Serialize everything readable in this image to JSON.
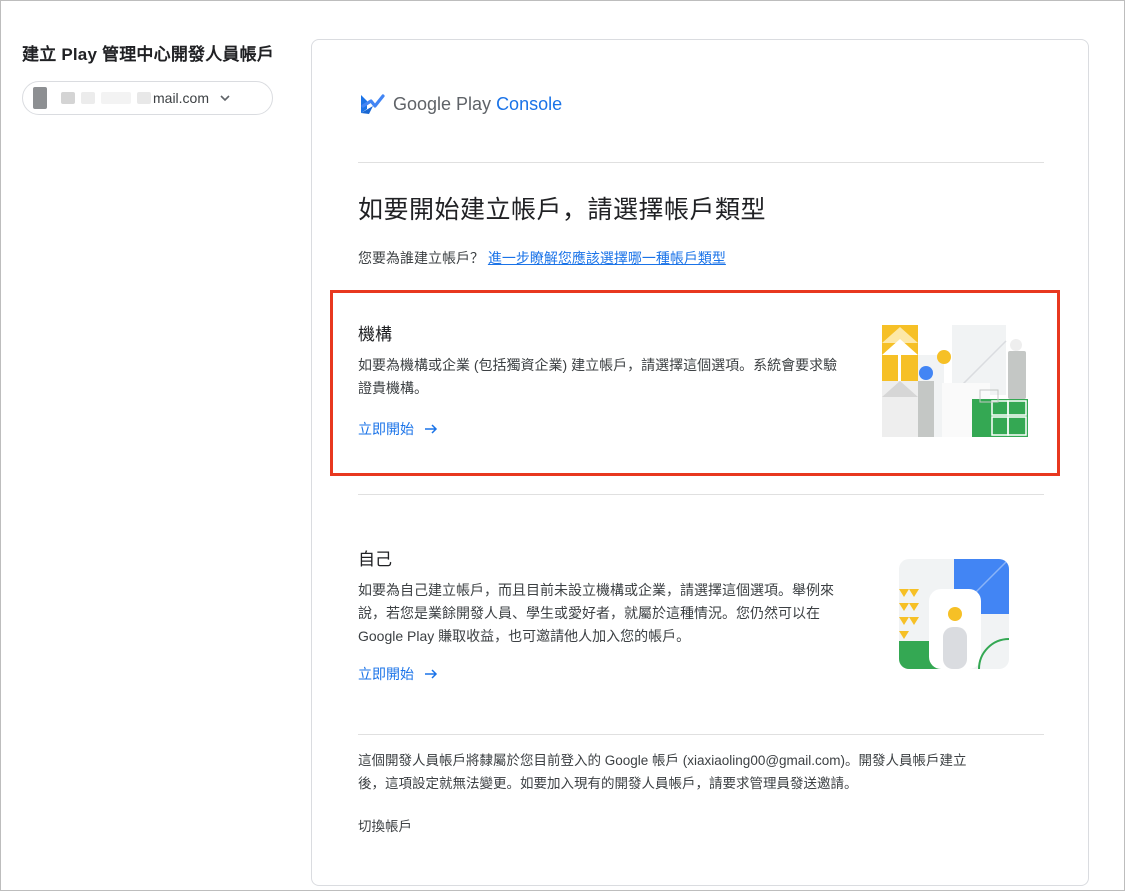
{
  "sidebar": {
    "title": "建立 Play 管理中心開發人員帳戶",
    "account_email_visible": "mail.com"
  },
  "logo": {
    "brand": "Google Play ",
    "product": "Console"
  },
  "main": {
    "heading": "如要開始建立帳戶，請選擇帳戶類型",
    "subtitle_prefix": "您要為誰建立帳戶？",
    "subtitle_link": "進一步瞭解您應該選擇哪一種帳戶類型"
  },
  "options": [
    {
      "title": "機構",
      "desc_lines": [
        "如要為機構或企業 (包括獨資企業) 建立帳戶，請選擇這個選項。系統會要求驗",
        "證貴機構。"
      ],
      "link": "立即開始"
    },
    {
      "title": "自己",
      "desc_lines": [
        "如要為自己建立帳戶，而且目前未設立機構或企業，請選擇這個選項。舉例來",
        "說，若您是業餘開發人員、學生或愛好者，就屬於這種情況。您仍然可以在",
        "Google Play 賺取收益，也可邀請他人加入您的帳戶。"
      ],
      "link": "立即開始"
    }
  ],
  "footer": {
    "lines": [
      "這個開發人員帳戶將隸屬於您目前登入的 Google 帳戶 (xiaxiaoling00@gmail.com)。開發人員帳戶建立",
      "後，這項設定就無法變更。如要加入現有的開發人員帳戶，請要求管理員發送邀請。"
    ],
    "switch_account": "切換帳戶"
  },
  "icons": {
    "chevron": "chevron-down-icon",
    "arrow": "arrow-right-icon",
    "logo": "play-console-logo-icon"
  },
  "colors": {
    "accent": "#1a73e8",
    "highlight_border": "#e8381f",
    "yellow": "#f6c026",
    "blue": "#4285f4",
    "green": "#34a853"
  }
}
